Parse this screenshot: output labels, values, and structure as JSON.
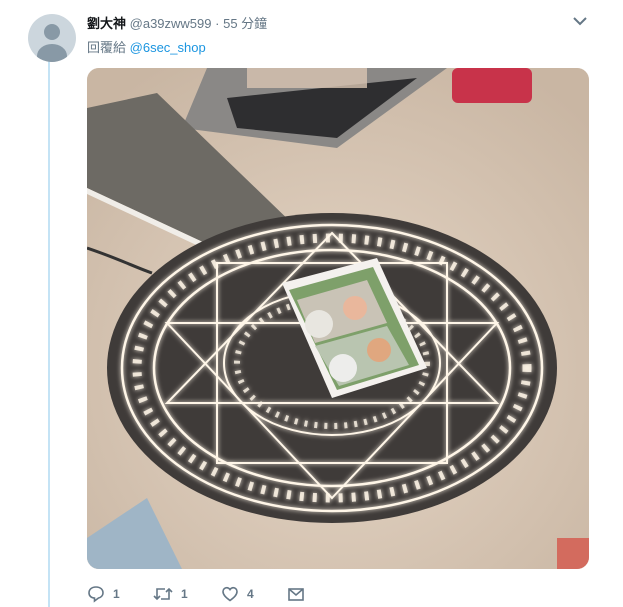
{
  "tweet": {
    "author_name": "劉大神",
    "handle": "@a39zww599",
    "separator": "·",
    "time": "55 分鐘",
    "replying_prefix": "回覆給",
    "replying_to": "@6sec_shop"
  },
  "actions": {
    "reply_count": "1",
    "retweet_count": "1",
    "like_count": "4"
  },
  "icons": {
    "caret": "chevron-down-icon",
    "reply": "reply-icon",
    "retweet": "retweet-icon",
    "like": "heart-icon",
    "dm": "envelope-icon"
  },
  "colors": {
    "link": "#1b95e0",
    "secondary_text": "#657786",
    "thread_line": "#c4e3f5"
  }
}
